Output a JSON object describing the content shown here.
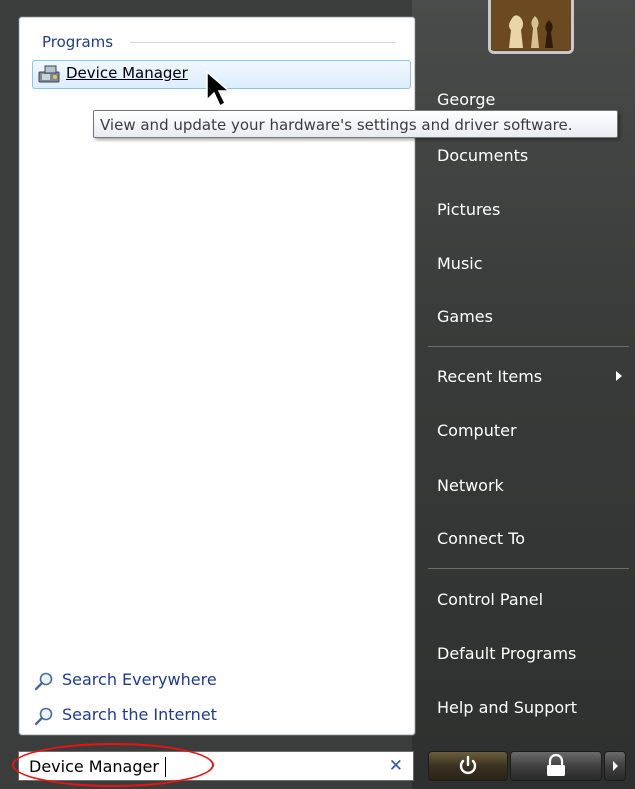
{
  "left": {
    "programs_header": "Programs",
    "result_label": "Device Manager",
    "tooltip": "View and update your hardware's settings and driver software.",
    "search_everywhere": "Search Everywhere",
    "search_internet": "Search the Internet"
  },
  "search": {
    "value": "Device Manager",
    "clear_icon": "x-icon"
  },
  "right": {
    "items": [
      {
        "label": "George"
      },
      {
        "label": "Documents"
      },
      {
        "label": "Pictures"
      },
      {
        "label": "Music"
      },
      {
        "label": "Games"
      },
      {
        "label": "Recent Items"
      },
      {
        "label": "Computer"
      },
      {
        "label": "Network"
      },
      {
        "label": "Connect To"
      },
      {
        "label": "Control Panel"
      },
      {
        "label": "Default Programs"
      },
      {
        "label": "Help and Support"
      }
    ]
  },
  "colors": {
    "link_blue": "#1c3a94",
    "highlight_border": "#8cc4ee",
    "annotation_red": "#e11111"
  }
}
